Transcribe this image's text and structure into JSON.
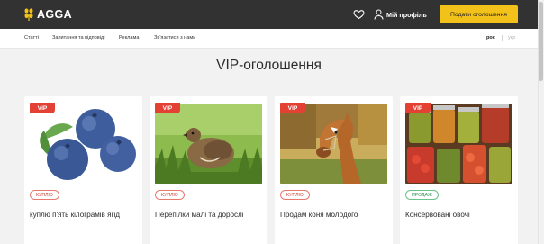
{
  "header": {
    "logo_text": "AGGA",
    "favorites_icon": "heart-icon",
    "user_icon": "user-icon",
    "profile_label": "Мій профіль",
    "cta_label": "Подати оголошення",
    "colors": {
      "bar": "#323232",
      "accent": "#f3c21a"
    }
  },
  "nav": {
    "links": [
      "Статті",
      "Запитання та відповіді",
      "Реклама",
      "Зв'язатися з нами"
    ],
    "languages": {
      "active": "рос",
      "inactive": "укр"
    }
  },
  "section": {
    "title": "VIP-оголошення"
  },
  "cards": [
    {
      "vip": "VIP",
      "image": "blueberries",
      "badge": "КУПЛЮ",
      "badge_type": "buy",
      "title": "куплю п'ять кілограмів ягід"
    },
    {
      "vip": "VIP",
      "image": "quail",
      "badge": "КУПЛЮ",
      "badge_type": "buy",
      "title": "Перепілки малі та дорослі"
    },
    {
      "vip": "VIP",
      "image": "horse",
      "badge": "КУПЛЮ",
      "badge_type": "buy",
      "title": "Продам коня молодого"
    },
    {
      "vip": "VIP",
      "image": "preserved-vegetables",
      "badge": "ПРОДАЖ",
      "badge_type": "sell",
      "title": "Консервовані овочі"
    }
  ]
}
